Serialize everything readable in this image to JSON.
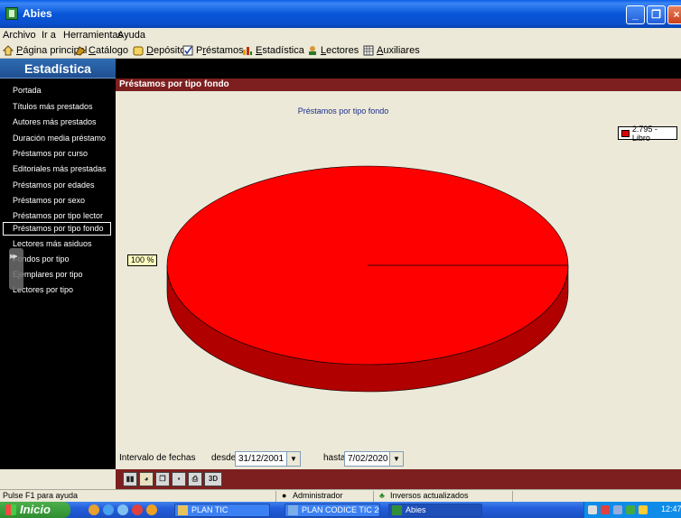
{
  "window": {
    "title": "Abies"
  },
  "menu": [
    "Archivo",
    "Ir a",
    "Herramientas",
    "Ayuda"
  ],
  "toolbar": [
    {
      "label_pre": "",
      "label_u": "P",
      "label_post": "ágina principal",
      "icon": "home-icon"
    },
    {
      "label_pre": "",
      "label_u": "C",
      "label_post": "atálogo",
      "icon": "catalog-icon"
    },
    {
      "label_pre": "",
      "label_u": "D",
      "label_post": "epósito",
      "icon": "deposit-icon"
    },
    {
      "label_pre": "P",
      "label_u": "r",
      "label_post": "éstamos",
      "icon": "loans-icon"
    },
    {
      "label_pre": "",
      "label_u": "E",
      "label_post": "stadística",
      "icon": "stats-icon"
    },
    {
      "label_pre": "",
      "label_u": "L",
      "label_post": "ectores",
      "icon": "readers-icon"
    },
    {
      "label_pre": "",
      "label_u": "A",
      "label_post": "uxiliares",
      "icon": "aux-icon"
    }
  ],
  "sidebar": {
    "title": "Estadística",
    "items": [
      "Portada",
      "Títulos más prestados",
      "Autores más prestados",
      "Duración media préstamo",
      "Préstamos por curso",
      "Editoriales más prestadas",
      "Préstamos por edades",
      "Préstamos por sexo",
      "Préstamos por tipo lector",
      "Préstamos por tipo fondo",
      "Lectores más asiduos",
      "Fondos por tipo",
      "Ejemplares por tipo",
      "Lectores por tipo"
    ],
    "active_index": 9
  },
  "main": {
    "header": "Préstamos por tipo fondo",
    "date_range_label": "Intervalo de fechas",
    "from_label": "desde",
    "from_value": "31/12/2001",
    "to_label": "hasta",
    "to_value": "7/02/2020"
  },
  "chart_data": {
    "type": "pie",
    "title": "Préstamos por tipo fondo",
    "slices": [
      {
        "label": "Libro",
        "value": 2795,
        "percent": 100,
        "color": "#ff0000"
      }
    ],
    "legend": [
      "2.795  - Libro"
    ],
    "percent_labels": [
      "100 %"
    ],
    "legend_position": "top-right",
    "three_d": true
  },
  "toolstrip": [
    "bar-chart-icon",
    "pie-chart-icon",
    "copy-icon",
    "save-icon",
    "print-icon",
    "3d-toggle-icon"
  ],
  "toolstrip_3d_label": "3D",
  "statusbar": {
    "hint": "Pulse F1 para ayuda",
    "user": "Administrador",
    "status": "Inversos actualizados"
  },
  "taskbar": {
    "start_label": "Inicio",
    "tasks": [
      "PLAN TIC",
      "PLAN CODICE TIC 20...",
      "Abies"
    ],
    "clock": "12:47"
  },
  "colors": {
    "accent_maroon": "#7d1f1f",
    "pie_red": "#ff0000",
    "sidebar_bg": "#000000",
    "titlebar_blue": "#0a5fe8"
  }
}
